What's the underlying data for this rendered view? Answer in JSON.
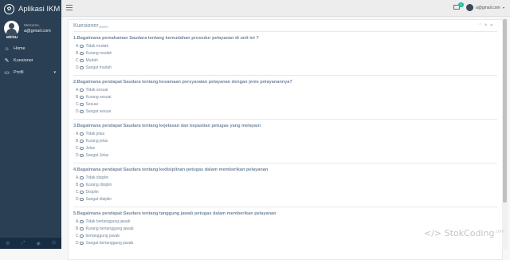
{
  "sidebar": {
    "app_title": "Aplikasi IKM",
    "welcome": "Welcome,",
    "email": "a@gmail.com",
    "menu_title": "MENU",
    "items": [
      {
        "label": "Home",
        "icon": "home-icon"
      },
      {
        "label": "Kuesioner",
        "icon": "edit-icon"
      },
      {
        "label": "Profil",
        "icon": "desktop-icon"
      }
    ]
  },
  "topbar": {
    "notif_count": "1",
    "user_email": "a@gmail.com"
  },
  "panel": {
    "title": "Kuesioner",
    "subtitle": "Users",
    "questions": [
      {
        "title": "1.Bagaimana pemahaman Saudara tentang kemudahan prosedur pelayanan di unit ini ?",
        "options": [
          {
            "letter": "A",
            "label": "Tidak mudah"
          },
          {
            "letter": "B",
            "label": "Kurang mudah"
          },
          {
            "letter": "C",
            "label": "Mudah"
          },
          {
            "letter": "D",
            "label": "Sangat mudah"
          }
        ]
      },
      {
        "title": "2.Bagaimana pendapat Saudara tentang kesamaan persyaratan pelayanan dengan jenis pelayanannya?",
        "options": [
          {
            "letter": "A",
            "label": "Tidak sesuai"
          },
          {
            "letter": "B",
            "label": "Kurang sesuai"
          },
          {
            "letter": "C",
            "label": "Sesuai"
          },
          {
            "letter": "D",
            "label": "Sangat sesuai"
          }
        ]
      },
      {
        "title": "3.Bagaimana pendapat Saudara tentang kejelasan dan kepastian petugas yang melayani",
        "options": [
          {
            "letter": "A",
            "label": "Tidak jelas"
          },
          {
            "letter": "B",
            "label": "Kurang jelas"
          },
          {
            "letter": "C",
            "label": "Jelas"
          },
          {
            "letter": "D",
            "label": "Sangat Jelas"
          }
        ]
      },
      {
        "title": "4.Bagaimana pendapat Saudara tentang kedisiplinan petugas dalam memberikan pelayanan",
        "options": [
          {
            "letter": "A",
            "label": "Tidak disiplin"
          },
          {
            "letter": "B",
            "label": "Kurang disiplin"
          },
          {
            "letter": "C",
            "label": "Disiplin"
          },
          {
            "letter": "D",
            "label": "Sangat disiplin"
          }
        ]
      },
      {
        "title": "5.Bagaimana pendapat Saudara tentang tanggung jawab petugas dalam memberikan pelayanan",
        "options": [
          {
            "letter": "A",
            "label": "Tidak bertanggung jawab"
          },
          {
            "letter": "B",
            "label": "Kurang bertanggung jawab"
          },
          {
            "letter": "C",
            "label": "bertanggung jawab"
          },
          {
            "letter": "D",
            "label": "Sangat bertanggung jawab"
          }
        ]
      }
    ]
  },
  "watermark": {
    "text": "</> StokCoding",
    "suffix": ".com"
  }
}
